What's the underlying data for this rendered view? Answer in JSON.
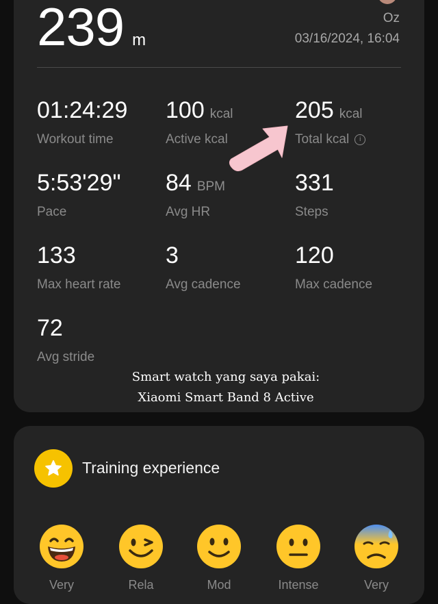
{
  "summary": {
    "distance_value": "239",
    "distance_unit": "m",
    "user_name": "Oz",
    "datetime": "03/16/2024, 16:04"
  },
  "stats": [
    {
      "value": "01:24:29",
      "unit": "",
      "label": "Workout time"
    },
    {
      "value": "100",
      "unit": "kcal",
      "label": "Active kcal"
    },
    {
      "value": "205",
      "unit": "kcal",
      "label": "Total kcal"
    },
    {
      "value": "5:53'29\"",
      "unit": "",
      "label": "Pace"
    },
    {
      "value": "84",
      "unit": "BPM",
      "label": "Avg HR"
    },
    {
      "value": "331",
      "unit": "",
      "label": "Steps"
    },
    {
      "value": "133",
      "unit": "",
      "label": "Max heart rate"
    },
    {
      "value": "3",
      "unit": "",
      "label": "Avg cadence"
    },
    {
      "value": "120",
      "unit": "",
      "label": "Max cadence"
    },
    {
      "value": "72",
      "unit": "",
      "label": "Avg stride"
    }
  ],
  "overlay": {
    "caption_line1": "Smart watch yang saya pakai:",
    "caption_line2": "Xiaomi Smart Band 8 Active",
    "arrow_color": "#f7c6cf"
  },
  "experience": {
    "title": "Training experience",
    "options": [
      {
        "icon": "grinning-face-icon",
        "label": "Very"
      },
      {
        "icon": "winking-face-icon",
        "label": "Rela"
      },
      {
        "icon": "smiling-face-icon",
        "label": "Mod"
      },
      {
        "icon": "neutral-face-icon",
        "label": "Intense"
      },
      {
        "icon": "anxious-sweat-face-icon",
        "label": "Very"
      }
    ]
  },
  "colors": {
    "background": "#0f0f0f",
    "card": "#242424",
    "accent_yellow": "#f6c200",
    "secondary_text": "#8a8a8a"
  }
}
